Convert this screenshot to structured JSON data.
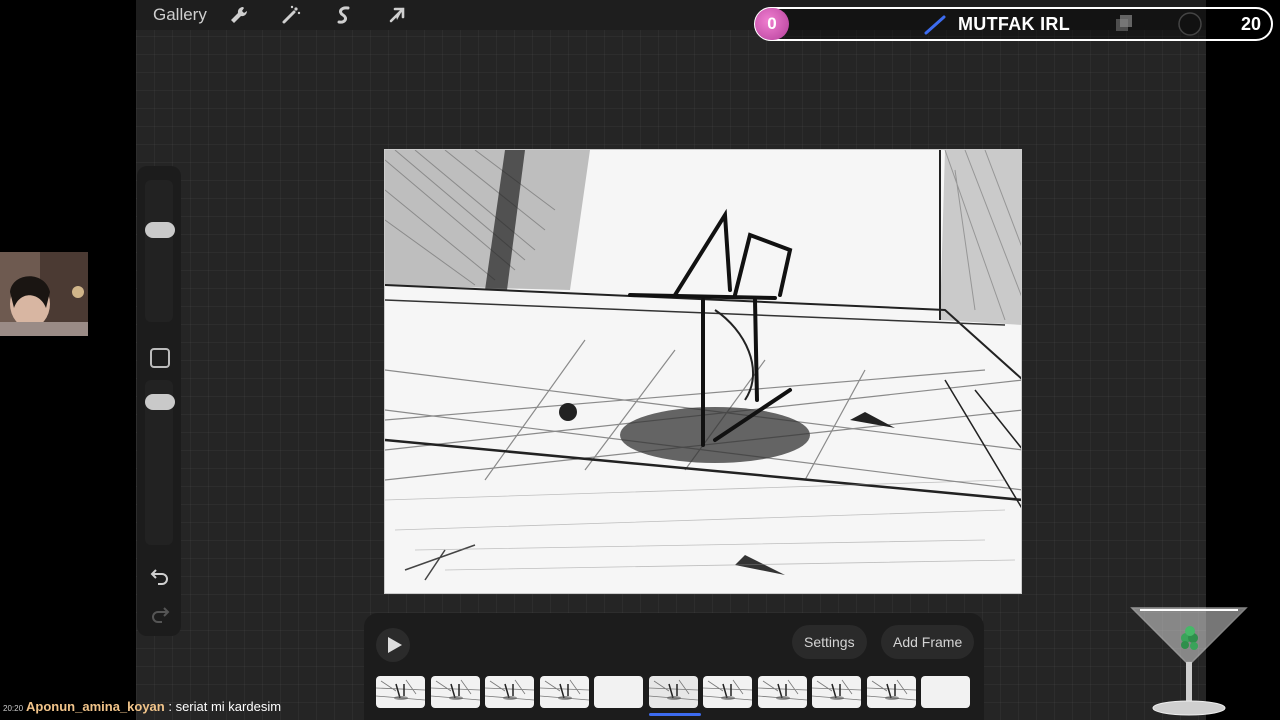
{
  "toolbar": {
    "gallery_label": "Gallery",
    "icons": [
      "wrench-icon",
      "magic-wand-icon",
      "selection-icon",
      "transform-arrow-icon"
    ]
  },
  "animation": {
    "settings_label": "Settings",
    "add_frame_label": "Add Frame",
    "frames": [
      {
        "kind": "sketch"
      },
      {
        "kind": "sketch"
      },
      {
        "kind": "sketch"
      },
      {
        "kind": "sketch"
      },
      {
        "kind": "blank"
      },
      {
        "kind": "sketch",
        "active": true
      },
      {
        "kind": "sketch"
      },
      {
        "kind": "sketch"
      },
      {
        "kind": "sketch"
      },
      {
        "kind": "sketch"
      },
      {
        "kind": "blank"
      }
    ]
  },
  "overlay": {
    "left_counter": "0",
    "title": "MUTFAK IRL",
    "right_counter": "20"
  },
  "chat": {
    "time": "20:20",
    "user": "Aponun_amina_koyan",
    "separator": " : ",
    "message": "seriat mi kardesim"
  },
  "colors": {
    "app_background": "#252525",
    "accent_blue": "#3d6cf0",
    "counter_pink": "#d35bb5"
  }
}
